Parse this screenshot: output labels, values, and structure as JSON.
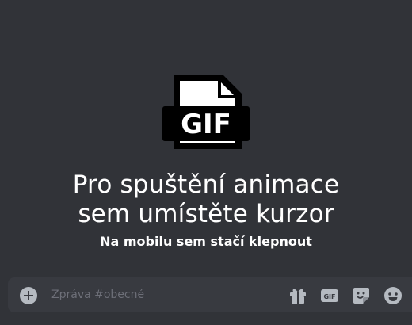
{
  "overlay": {
    "icon": "gif-file-icon",
    "icon_text": "GIF",
    "title_line1": "Pro spuštění animace",
    "title_line2": "sem umístěte kurzor",
    "subtitle": "Na mobilu sem stačí klepnout"
  },
  "composer": {
    "placeholder": "Zpráva #obecné",
    "add_icon": "plus-circle-icon",
    "tools": [
      "gift-icon",
      "gif-icon",
      "sticker-icon",
      "emoji-icon"
    ],
    "gif_label": "GIF"
  },
  "colors": {
    "background": "#313338",
    "composer_background": "#383a40",
    "icon": "#b5bac1",
    "placeholder": "#6d6f78",
    "text": "#ffffff"
  }
}
